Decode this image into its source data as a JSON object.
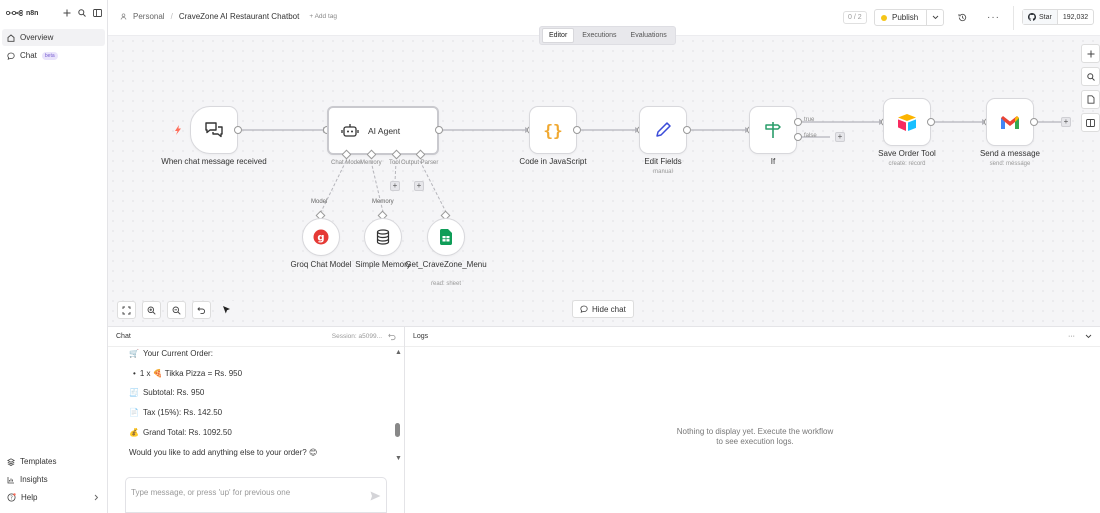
{
  "sidebar": {
    "brand": "n8n",
    "items": [
      {
        "label": "Overview",
        "active": true
      },
      {
        "label": "Chat",
        "badge": "beta"
      }
    ],
    "bottom_items": [
      {
        "label": "Templates"
      },
      {
        "label": "Insights"
      },
      {
        "label": "Help"
      }
    ]
  },
  "header": {
    "project": "Personal",
    "workflow_name": "CraveZone AI Restaurant Chatbot",
    "add_tag": "+ Add tag",
    "counter": "0 / 2",
    "publish_label": "Publish",
    "github_star": "Star",
    "github_count": "192,032"
  },
  "canvas": {
    "tabs": [
      "Editor",
      "Executions",
      "Evaluations"
    ],
    "active_tab": "Editor",
    "nodes": {
      "trigger": {
        "label": "When chat message received"
      },
      "agent": {
        "label": "AI Agent",
        "handles": [
          "Chat Model",
          "Memory",
          "Tool",
          "Output Parser"
        ]
      },
      "code": {
        "label": "Code in JavaScript"
      },
      "edit": {
        "label": "Edit Fields",
        "sub": "manual"
      },
      "if": {
        "label": "If",
        "branches": [
          "true",
          "false"
        ]
      },
      "airtable": {
        "label": "Save Order Tool",
        "sub": "create: record"
      },
      "gmail": {
        "label": "Send a message",
        "sub": "send: message"
      },
      "groq": {
        "label": "Groq Chat Model",
        "connection": "Model"
      },
      "memory": {
        "label": "Simple Memory",
        "connection": "Memory"
      },
      "sheets": {
        "label": "Get_CraveZone_Menu",
        "sub": "read: sheet"
      }
    },
    "hide_chat": "Hide chat"
  },
  "chat": {
    "title": "Chat",
    "session": "Session: a5099...",
    "messages": [
      {
        "icon": "🛒",
        "text": "Your Current Order:"
      },
      {
        "icon": "•",
        "text": "1 x 🍕 Tikka Pizza = Rs. 950"
      },
      {
        "icon": "🧾",
        "text": "Subtotal: Rs. 950"
      },
      {
        "icon": "📄",
        "text": "Tax (15%): Rs. 142.50"
      },
      {
        "icon": "💰",
        "text": "Grand Total: Rs. 1092.50"
      },
      {
        "icon": "",
        "text": "Would you like to add anything else to your order? 😊"
      }
    ],
    "input_placeholder": "Type message, or press 'up' for previous one"
  },
  "logs": {
    "title": "Logs",
    "empty": "Nothing to display yet. Execute the workflow to see execution logs."
  },
  "colors": {
    "accent": "#ff6d5a",
    "publish_dot": "#f5c518",
    "code_icon": "#f0a830",
    "edit_icon": "#3b4cd9",
    "if_icon": "#2a9d6a"
  }
}
